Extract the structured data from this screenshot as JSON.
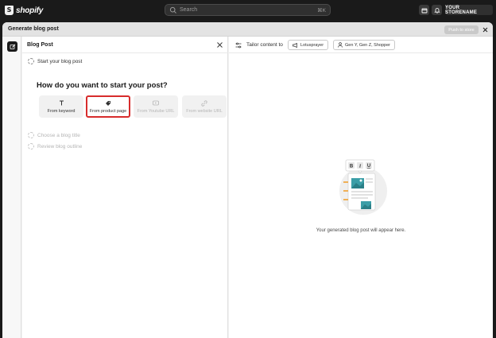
{
  "topbar": {
    "brand": "shopify",
    "search_placeholder": "Search",
    "search_shortcut": "⌘K",
    "store_label": "YOUR STORENAME"
  },
  "modal": {
    "title": "Generate blog post",
    "push_label": "Push to store"
  },
  "left_panel": {
    "title": "Blog Post",
    "steps": [
      {
        "label": "Start your blog post",
        "state": "active"
      },
      {
        "label": "Choose a blog title",
        "state": "pending"
      },
      {
        "label": "Review blog outline",
        "state": "pending"
      }
    ],
    "question": "How do you want to start your post?",
    "options": [
      {
        "label": "From keyword",
        "icon": "text-icon",
        "state": "enabled"
      },
      {
        "label": "From product page",
        "icon": "tag-icon",
        "state": "selected"
      },
      {
        "label": "From Youtube URL",
        "icon": "youtube-icon",
        "state": "disabled"
      },
      {
        "label": "From website URL",
        "icon": "link-icon",
        "state": "disabled"
      }
    ]
  },
  "right_panel": {
    "tailor_label": "Tailor content to",
    "brand_chip": "Lotusprayer",
    "audience_chip": "Gen Y, Gen Z, Shopper",
    "placeholder": "Your generated blog post will appear here."
  },
  "colors": {
    "selected_border": "#d72c2c",
    "topbar_bg": "#1a1a1a"
  }
}
